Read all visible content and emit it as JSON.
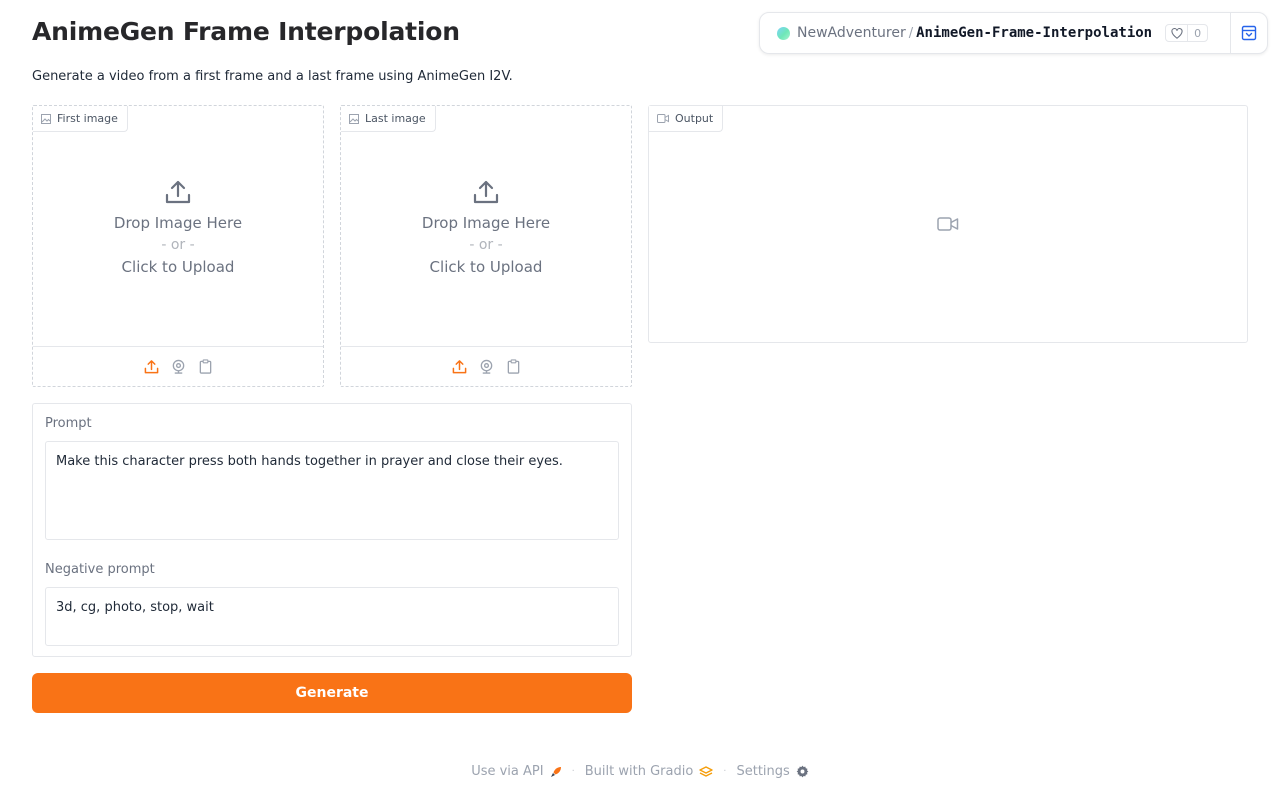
{
  "header": {
    "title": "AnimeGen Frame Interpolation",
    "description": "Generate a video from a first frame and a last frame using AnimeGen I2V."
  },
  "space": {
    "owner": "NewAdventurer",
    "separator": "/",
    "name": "AnimeGen-Frame-Interpolation",
    "likes": "0"
  },
  "inputs": {
    "first_image": {
      "label": "First image",
      "drop_text": "Drop Image Here",
      "or_text": "- or -",
      "click_text": "Click to Upload"
    },
    "last_image": {
      "label": "Last image",
      "drop_text": "Drop Image Here",
      "or_text": "- or -",
      "click_text": "Click to Upload"
    }
  },
  "output": {
    "label": "Output"
  },
  "form": {
    "prompt_label": "Prompt",
    "prompt_value": "Make this character press both hands together in prayer and close their eyes.",
    "negative_label": "Negative prompt",
    "negative_value": "3d, cg, photo, stop, wait"
  },
  "actions": {
    "generate_label": "Generate"
  },
  "footer": {
    "api_label": "Use via API",
    "built_label": "Built with Gradio",
    "settings_label": "Settings"
  },
  "colors": {
    "accent": "#f97316",
    "text": "#1f2937",
    "muted": "#6b7280",
    "border": "#e5e7eb"
  }
}
